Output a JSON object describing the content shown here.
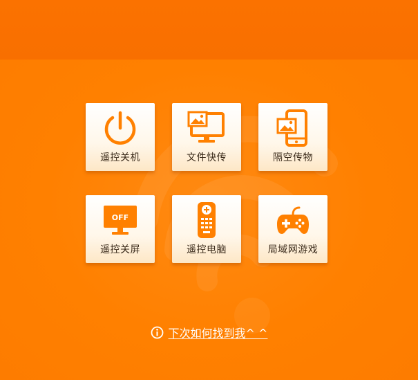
{
  "tiles": [
    {
      "label": "遥控关机",
      "icon": "power-icon"
    },
    {
      "label": "文件快传",
      "icon": "monitor-picture-icon"
    },
    {
      "label": "隔空传物",
      "icon": "phone-picture-icon"
    },
    {
      "label": "遥控关屏",
      "icon": "monitor-off-icon"
    },
    {
      "label": "遥控电脑",
      "icon": "remote-control-icon"
    },
    {
      "label": "局域网游戏",
      "icon": "gamepad-icon"
    }
  ],
  "screen_off_text": "OFF",
  "help": {
    "link_text": "下次如何找到我^ ^",
    "icon": "info-icon"
  },
  "colors": {
    "accent": "#ff8000",
    "icon": "#ff8000",
    "topbar": "#fb7200",
    "tile_bg": "#fff7ea"
  }
}
